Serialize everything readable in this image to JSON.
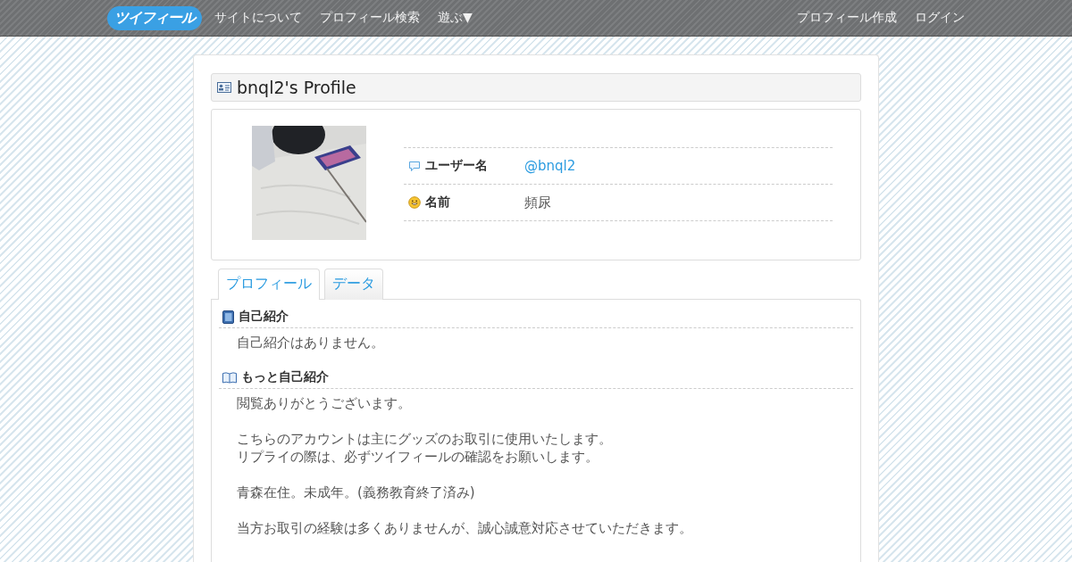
{
  "header": {
    "logo": "ツイフィール",
    "nav_left": [
      {
        "label": "サイトについて"
      },
      {
        "label": "プロフィール検索"
      },
      {
        "label": "遊ぶ▼"
      }
    ],
    "nav_right": [
      {
        "label": "プロフィール作成"
      },
      {
        "label": "ログイン"
      }
    ]
  },
  "profile": {
    "title": "bnql2's Profile",
    "fields": [
      {
        "kind": "username",
        "label": "ユーザー名",
        "value": "@bnql2",
        "link": true
      },
      {
        "kind": "name",
        "label": "名前",
        "value": "頻尿",
        "link": false
      }
    ]
  },
  "tabs": [
    {
      "label": "プロフィール",
      "selected": true
    },
    {
      "label": "データ",
      "selected": false
    }
  ],
  "sections": [
    {
      "kind": "intro",
      "heading": "自己紹介",
      "paragraphs": [
        [
          "自己紹介はありません。"
        ]
      ]
    },
    {
      "kind": "more",
      "heading": "もっと自己紹介",
      "paragraphs": [
        [
          "閲覧ありがとうございます。"
        ],
        [
          "こちらのアカウントは主にグッズのお取引に使用いたします。",
          "リプライの際は、必ずツイフィールの確認をお願いします。"
        ],
        [
          "青森在住。未成年。(義務教育終了済み)"
        ],
        [
          "当方お取引の経験は多くありませんが、誠心誠意対応させていただきます。"
        ]
      ]
    }
  ]
}
